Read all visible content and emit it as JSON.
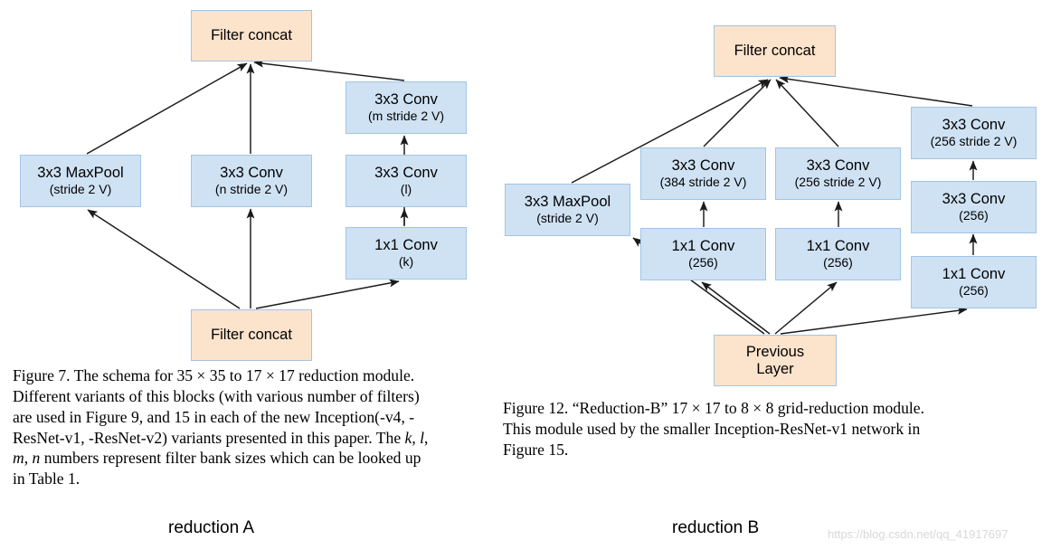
{
  "figure_left": {
    "name": "reduction-A",
    "bottom_label": "reduction A",
    "nodes": {
      "top_concat": "Filter concat",
      "maxpool_l1": "3x3 MaxPool",
      "maxpool_l2": "(stride 2 V)",
      "conv_n_l1": "3x3 Conv",
      "conv_n_l2": "(n stride 2 V)",
      "conv_m_l1": "3x3 Conv",
      "conv_m_l2": "(m stride 2 V)",
      "conv_l_l1": "3x3 Conv",
      "conv_l_l2": "(l)",
      "conv_k_l1": "1x1 Conv",
      "conv_k_l2": "(k)",
      "bottom_concat": "Filter concat"
    },
    "caption": {
      "line1_a": "Figure 7. The schema for ",
      "line1_n1": "35",
      "line1_x1": " × ",
      "line1_n2": "35",
      "line1_b": " to ",
      "line1_n3": "17",
      "line1_x2": " × ",
      "line1_n4": "17",
      "line1_c": " reduction module.",
      "line2": "Different variants of this blocks (with various number of filters)",
      "line3": "are used in Figure 9, and 15 in each of the new Inception(-v4, -",
      "line4_a": "ResNet-v1, -ResNet-v2) variants presented in this paper. The ",
      "line4_k": "k",
      "line4_comma1": ", ",
      "line4_l": "l",
      "line4_comma2": ",",
      "line5_m": "m",
      "line5_comma": ", ",
      "line5_n": "n",
      "line5_rest": " numbers represent filter bank sizes which can be looked up",
      "line6": "in Table 1."
    }
  },
  "figure_right": {
    "name": "reduction-B",
    "bottom_label": "reduction B",
    "nodes": {
      "top_concat": "Filter concat",
      "maxpool_l1": "3x3 MaxPool",
      "maxpool_l2": "(stride 2 V)",
      "conv384_l1": "3x3 Conv",
      "conv384_l2": "(384 stride 2 V)",
      "conv256a_l1": "3x3 Conv",
      "conv256a_l2": "(256 stride 2 V)",
      "conv256b_l1": "3x3 Conv",
      "conv256b_l2": "(256 stride 2 V)",
      "conv256c_l1": "3x3 Conv",
      "conv256c_l2": "(256)",
      "conv1x1_a_l1": "1x1 Conv",
      "conv1x1_a_l2": "(256)",
      "conv1x1_b_l1": "1x1 Conv",
      "conv1x1_b_l2": "(256)",
      "conv1x1_c_l1": "1x1 Conv",
      "conv1x1_c_l2": "(256)",
      "previous_layer_l1": "Previous",
      "previous_layer_l2": "Layer"
    },
    "caption": {
      "line1_a": "Figure 12. “Reduction-B” ",
      "line1_n1": "17",
      "line1_x1": " × ",
      "line1_n2": "17",
      "line1_b": " to ",
      "line1_n3": "8",
      "line1_x2": " × ",
      "line1_n4": "8",
      "line1_c": " grid-reduction module.",
      "line2": "This module used by the smaller Inception-ResNet-v1 network in",
      "line3": "Figure 15."
    }
  },
  "colors": {
    "node_blue_fill": "#cfe2f3",
    "node_blue_border": "#9fc5e8",
    "node_peach_fill": "#fbe3cc",
    "node_peach_border": "#a7c3e0",
    "arrow": "#1a1a1a",
    "watermark": "#d8d8d8"
  },
  "watermark": "https://blog.csdn.net/qq_41917697"
}
